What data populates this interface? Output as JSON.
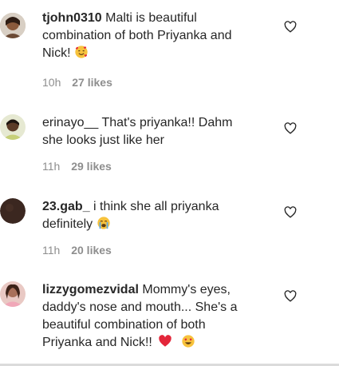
{
  "comments": [
    {
      "username": "tjohn0310",
      "text_lines": [
        "Malti is beautiful",
        "combination of both Priyanka and",
        "Nick!"
      ],
      "emojis": [
        "smiling-face-with-hearts"
      ],
      "time": "10h",
      "likes": "27 likes",
      "avatar": "avatar-photo"
    },
    {
      "username": "erinayo__",
      "text_lines": [
        "That's priyanka!! Dahm",
        "she looks just like her"
      ],
      "emojis": [],
      "time": "11h",
      "likes": "29 likes",
      "avatar": "avatar-photo"
    },
    {
      "username": "23.gab_",
      "text_lines": [
        "i think she all priyanka",
        "definitely"
      ],
      "emojis": [
        "loudly-crying-face"
      ],
      "time": "11h",
      "likes": "20 likes",
      "avatar": "avatar-photo"
    },
    {
      "username": "lizzygomezvidal",
      "text_lines": [
        "Mommy's eyes,",
        "daddy's nose and mouth... She's a",
        "beautiful combination of both",
        "Priyanka and Nick!!"
      ],
      "emojis": [
        "red-heart",
        "heart-eyes"
      ],
      "time": "",
      "likes": "",
      "avatar": "avatar-photo"
    }
  ],
  "colors": {
    "text": "#262626",
    "meta": "#8e8e8e",
    "heart_red": "#e3263a",
    "emoji_yellow": "#f7c23c"
  }
}
